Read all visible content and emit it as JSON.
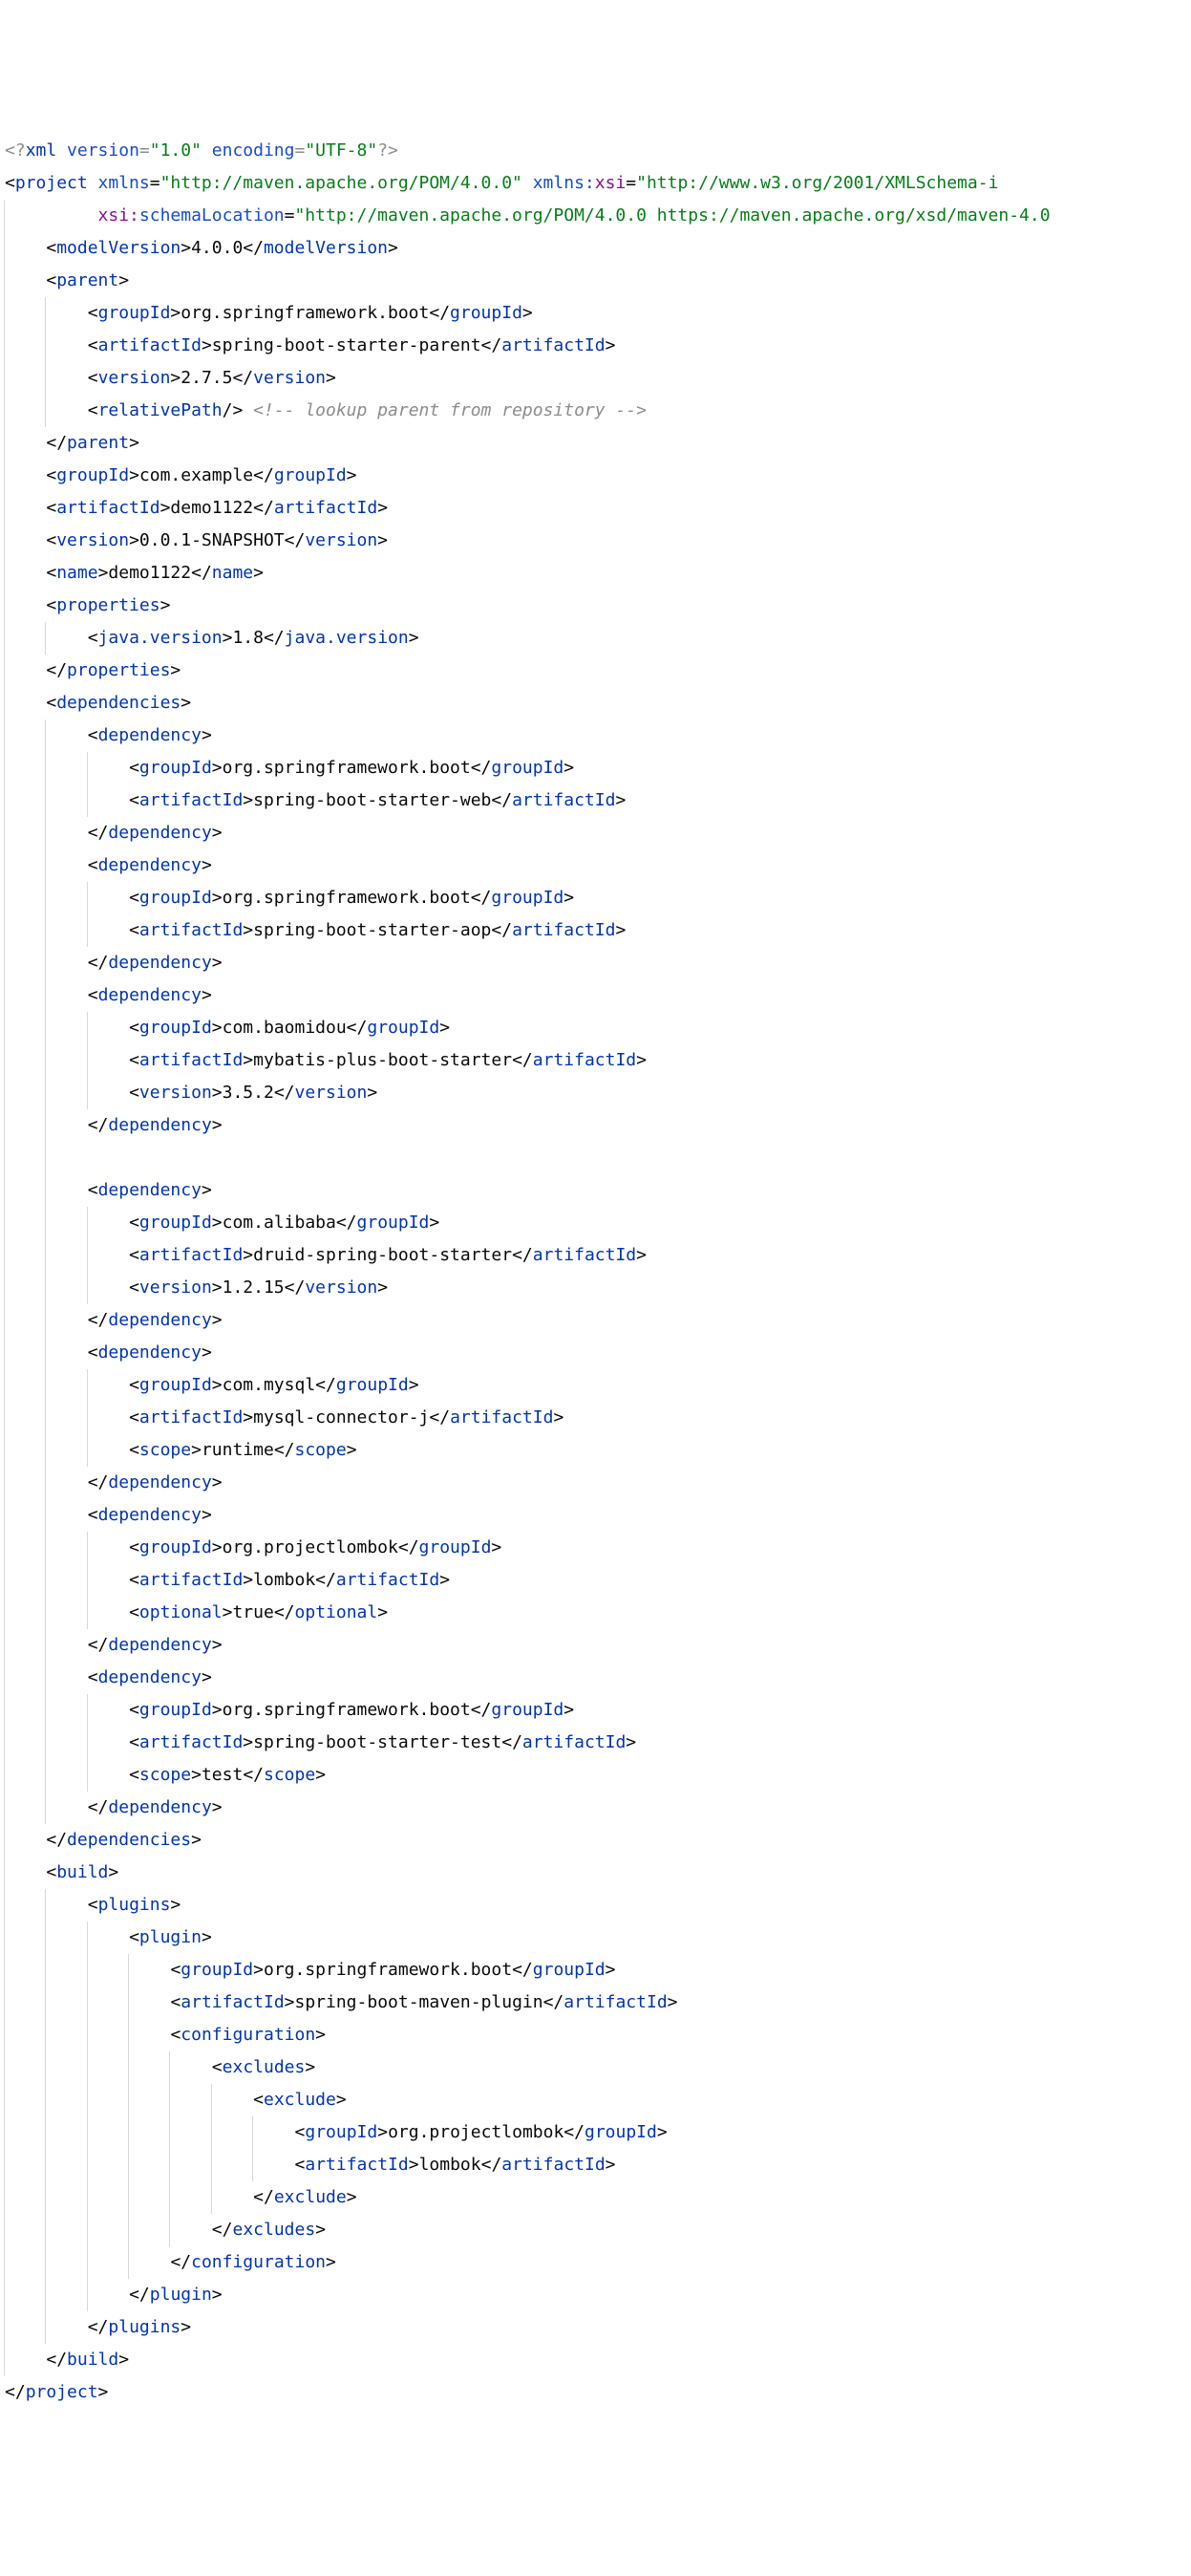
{
  "xml_decl": {
    "open": "<?",
    "name": "xml",
    "v_attr": "version",
    "v_val": "1.0",
    "e_attr": "encoding",
    "e_val": "UTF-8",
    "close": "?>"
  },
  "project": {
    "tag": "project",
    "xmlns_attr": "xmlns",
    "xmlns_val": "http://maven.apache.org/POM/4.0.0",
    "xsi_ns": "xmlns:",
    "xsi_attr": "xsi",
    "xsi_val": "http://www.w3.org/2001/XMLSchema-i",
    "sl_ns": "xsi:",
    "sl_attr": "schemaLocation",
    "sl_val": "http://maven.apache.org/POM/4.0.0 https://maven.apache.org/xsd/maven-4.0"
  },
  "modelVersion": {
    "tag": "modelVersion",
    "text": "4.0.0"
  },
  "parent": {
    "tag": "parent",
    "groupId": {
      "tag": "groupId",
      "text": "org.springframework.boot"
    },
    "artifactId": {
      "tag": "artifactId",
      "text": "spring-boot-starter-parent"
    },
    "version": {
      "tag": "version",
      "text": "2.7.5"
    },
    "relativePath_tag": "relativePath",
    "relativePath_comment": "<!-- lookup parent from repository -->"
  },
  "top": {
    "groupId": {
      "tag": "groupId",
      "text": "com.example"
    },
    "artifactId": {
      "tag": "artifactId",
      "text": "demo1122"
    },
    "version": {
      "tag": "version",
      "text": "0.0.1-SNAPSHOT"
    },
    "name": {
      "tag": "name",
      "text": "demo1122"
    }
  },
  "properties": {
    "tag": "properties",
    "java": {
      "tag": "java.version",
      "text": "1.8"
    }
  },
  "dependencies_tag": "dependencies",
  "dependency_tag": "dependency",
  "dep": [
    {
      "g": "org.springframework.boot",
      "a": "spring-boot-starter-web"
    },
    {
      "g": "org.springframework.boot",
      "a": "spring-boot-starter-aop"
    },
    {
      "g": "com.baomidou",
      "a": "mybatis-plus-boot-starter",
      "v": "3.5.2"
    },
    {
      "g": "com.alibaba",
      "a": "druid-spring-boot-starter",
      "v": "1.2.15"
    },
    {
      "g": "com.mysql",
      "a": "mysql-connector-j",
      "s": "runtime"
    },
    {
      "g": "org.projectlombok",
      "a": "lombok",
      "o": "true"
    },
    {
      "g": "org.springframework.boot",
      "a": "spring-boot-starter-test",
      "s": "test"
    }
  ],
  "tags": {
    "groupId": "groupId",
    "artifactId": "artifactId",
    "version": "version",
    "scope": "scope",
    "optional": "optional"
  },
  "build": {
    "tag": "build",
    "plugins": "plugins",
    "plugin": "plugin",
    "g": "org.springframework.boot",
    "a": "spring-boot-maven-plugin",
    "configuration": "configuration",
    "excludes": "excludes",
    "exclude": "exclude",
    "ex_g": "org.projectlombok",
    "ex_a": "lombok"
  },
  "sym": {
    "lt": "<",
    "lte": "</",
    "gt": ">",
    "gte": "/>",
    "eq": "=",
    "q": "\""
  }
}
